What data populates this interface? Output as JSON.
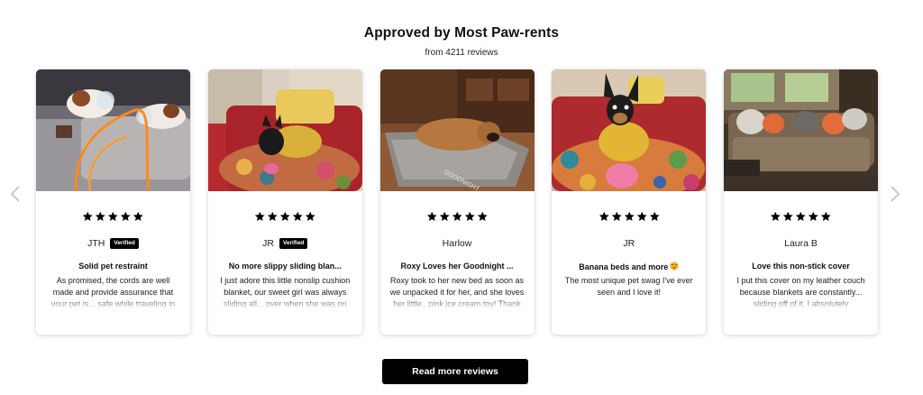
{
  "header": {
    "title": "Approved by Most Paw-rents",
    "subtitle": "from 4211 reviews"
  },
  "carousel": {
    "prev_icon": "chevron-left-icon",
    "next_icon": "chevron-right-icon"
  },
  "rating": {
    "stars": 5,
    "max": 5,
    "star_color": "#000000"
  },
  "reviews": [
    {
      "reviewer": "JTH",
      "verified": "Verified",
      "title": "Solid pet restraint",
      "text": "As promised, the cords are well made and provide assurance that your pet is... safe while traveling in the",
      "photo": "two dogs on a grey couch cushion with orange cords"
    },
    {
      "reviewer": "JR",
      "verified": "Verified",
      "title": "No more slippy sliding blan...",
      "text": "I just adore this little nonslip cushion blanket, our sweet girl was always sliding all... over when she was on the",
      "photo": "small black dog on a patterned cushion on a red leather sofa"
    },
    {
      "reviewer": "Harlow",
      "verified": "",
      "title": "Roxy Loves her Goodnight ...",
      "text": "Roxy took to her new bed as soon as we unpacked it for her, and she loves her little.. pink ice cream toy! Thank",
      "photo": "brown dog lying on a grey Goodnight bed"
    },
    {
      "reviewer": "JR",
      "verified": "",
      "title": "Banana beds and more",
      "title_emoji": "smiling-face-heart-eyes-emoji",
      "text": "The most unique pet swag I've ever seen and I love it!",
      "photo": "chihuahua in a yellow banana outfit on a colorful cushion"
    },
    {
      "reviewer": "Laura B",
      "verified": "",
      "title": "Love this non-stick cover",
      "text": "I put this cover on my leather couch because blankets are constantly... sliding off of it. I absolutely",
      "photo": "living room couch with a brown cover and throw pillows"
    }
  ],
  "cta": {
    "label": "Read more reviews"
  }
}
